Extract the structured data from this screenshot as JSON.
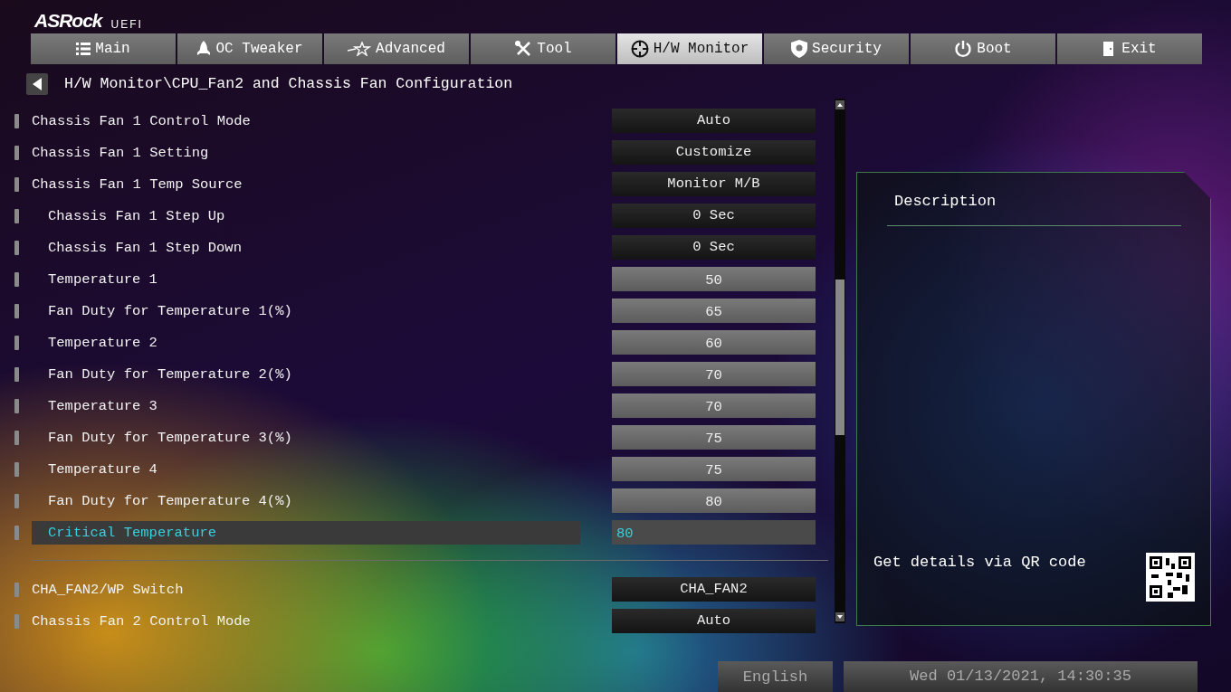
{
  "logo": {
    "brand": "ASRock",
    "suffix": "UEFI"
  },
  "tabs": [
    {
      "label": "Main",
      "selected": false
    },
    {
      "label": "OC Tweaker",
      "selected": false
    },
    {
      "label": "Advanced",
      "selected": false
    },
    {
      "label": "Tool",
      "selected": false
    },
    {
      "label": "H/W Monitor",
      "selected": true
    },
    {
      "label": "Security",
      "selected": false
    },
    {
      "label": "Boot",
      "selected": false
    },
    {
      "label": "Exit",
      "selected": false
    }
  ],
  "breadcrumb": "H/W Monitor\\CPU_Fan2 and Chassis Fan Configuration",
  "settings": {
    "groups": [
      {
        "items": [
          {
            "label": "Chassis Fan 1 Control Mode",
            "value": "Auto",
            "kind": "option",
            "selected": false
          },
          {
            "label": "Chassis Fan 1 Setting",
            "value": "Customize",
            "kind": "option",
            "selected": false
          },
          {
            "label": "Chassis Fan 1 Temp Source",
            "value": "Monitor M/B",
            "kind": "option",
            "selected": false,
            "children": [
              {
                "label": "Chassis Fan 1 Step Up",
                "value": "0 Sec",
                "kind": "option",
                "selected": false
              },
              {
                "label": "Chassis Fan 1 Step Down",
                "value": "0 Sec",
                "kind": "option",
                "selected": false
              },
              {
                "label": "Temperature 1",
                "value": "50",
                "kind": "number",
                "selected": false
              },
              {
                "label": "Fan Duty for Temperature 1(%)",
                "value": "65",
                "kind": "number",
                "selected": false
              },
              {
                "label": "Temperature 2",
                "value": "60",
                "kind": "number",
                "selected": false
              },
              {
                "label": "Fan Duty for Temperature 2(%)",
                "value": "70",
                "kind": "number",
                "selected": false
              },
              {
                "label": "Temperature 3",
                "value": "70",
                "kind": "number",
                "selected": false
              },
              {
                "label": "Fan Duty for Temperature 3(%)",
                "value": "75",
                "kind": "number",
                "selected": false
              },
              {
                "label": "Temperature 4",
                "value": "75",
                "kind": "number",
                "selected": false
              },
              {
                "label": "Fan Duty for Temperature 4(%)",
                "value": "80",
                "kind": "number",
                "selected": false
              },
              {
                "label": "Critical Temperature",
                "value": "80",
                "kind": "number",
                "selected": true
              }
            ]
          }
        ]
      },
      {
        "items": [
          {
            "label": "CHA_FAN2/WP Switch",
            "value": "CHA_FAN2",
            "kind": "option",
            "selected": false
          },
          {
            "label": "Chassis Fan 2 Control Mode",
            "value": "Auto",
            "kind": "option",
            "selected": false
          }
        ]
      }
    ]
  },
  "description": {
    "title": "Description",
    "qr_hint": "Get details via QR code"
  },
  "footer": {
    "language": "English",
    "datetime": "Wed 01/13/2021, 14:30:35"
  }
}
